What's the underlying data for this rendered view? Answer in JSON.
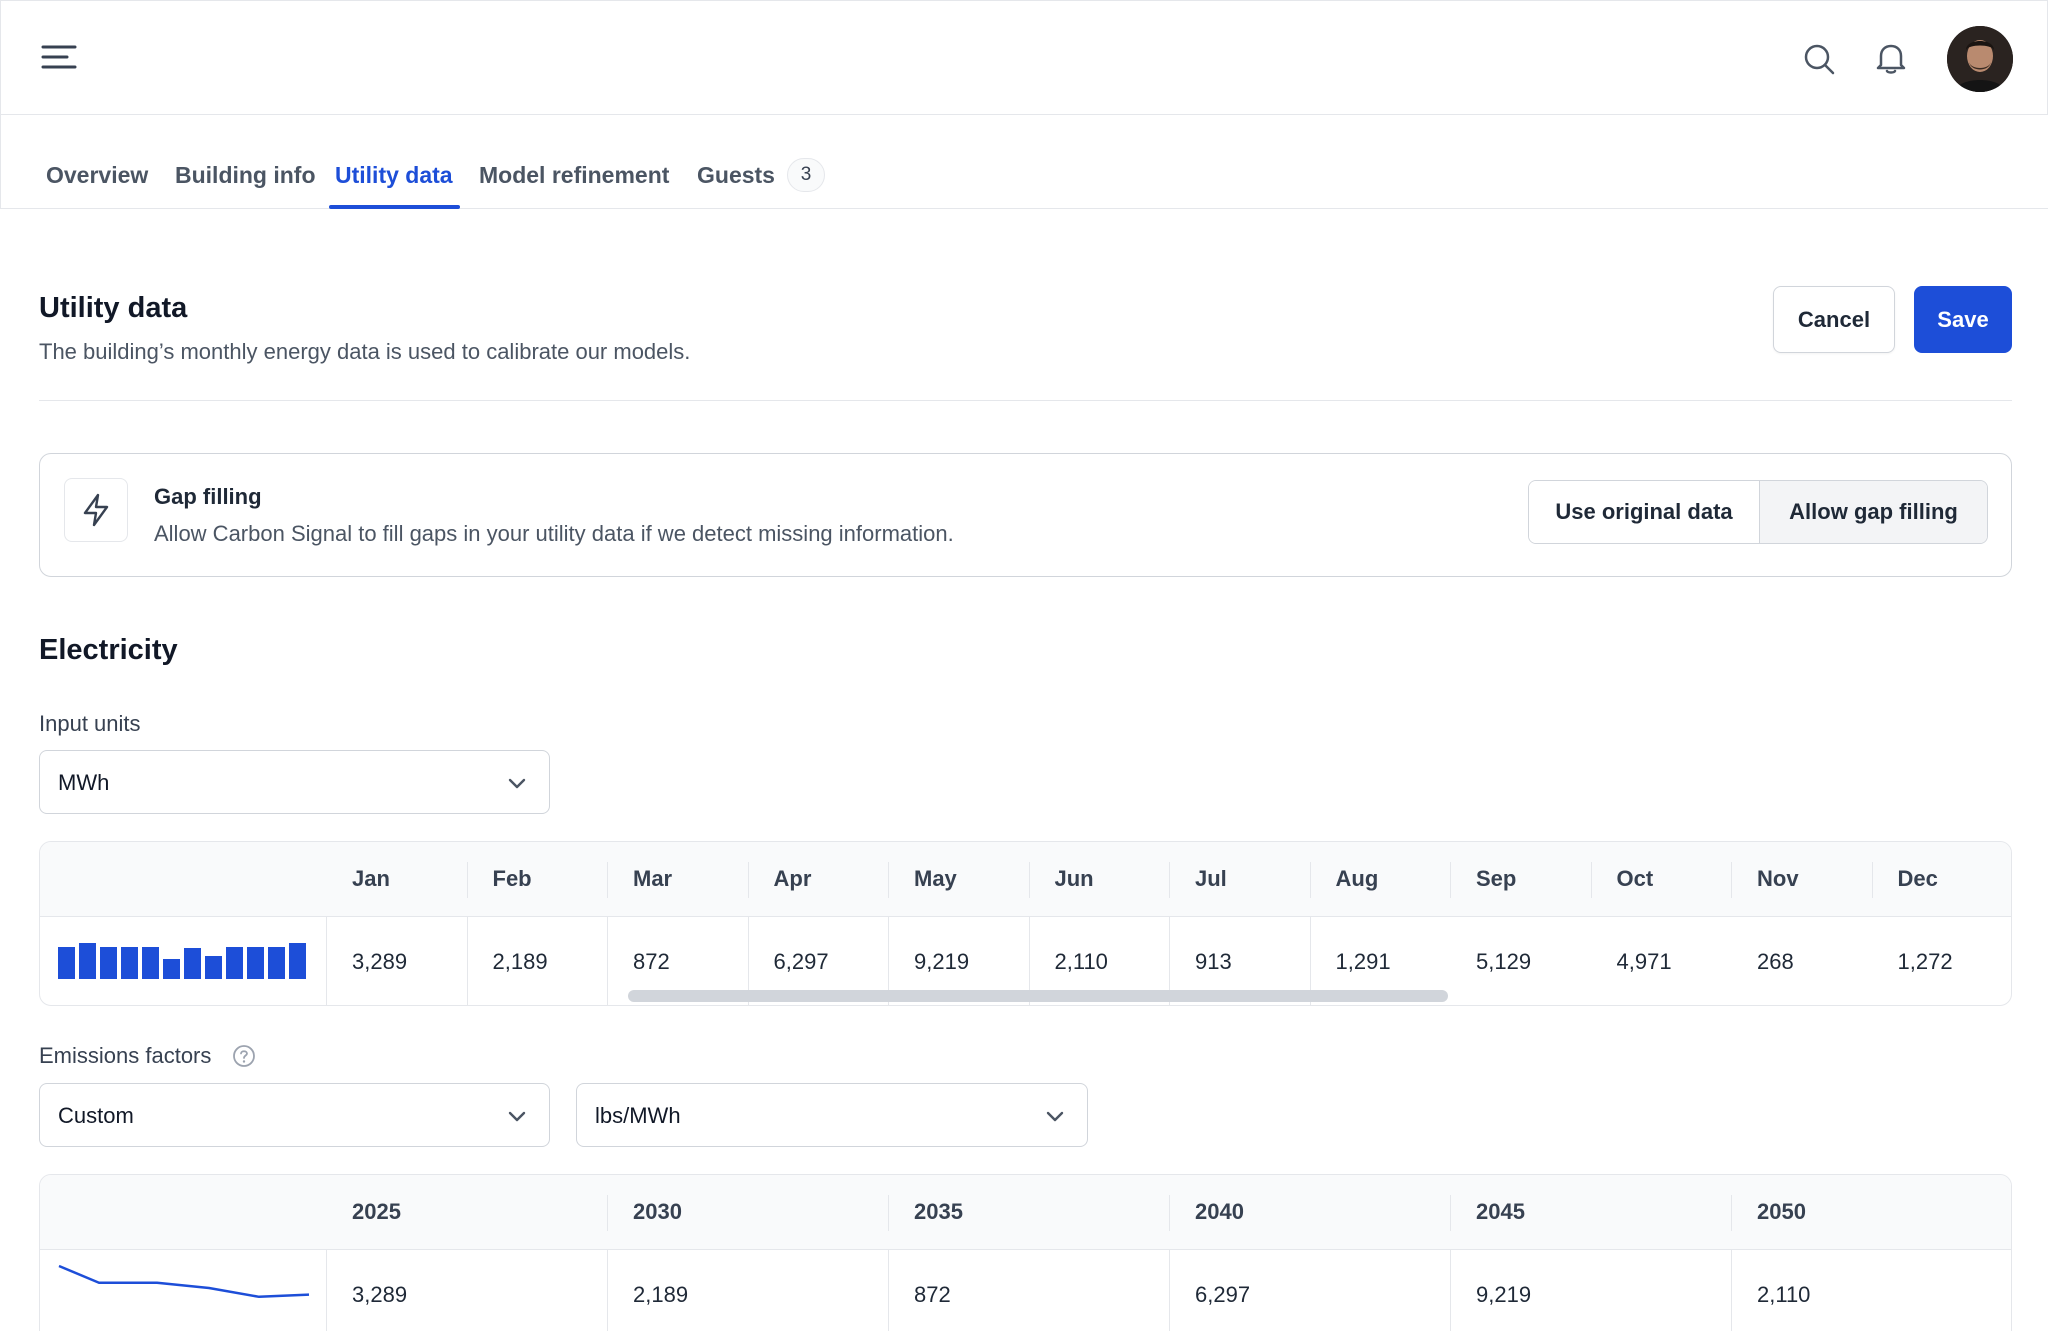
{
  "header": {
    "menu_icon": "hamburger-menu-icon",
    "search_icon": "search-icon",
    "bell_icon": "bell-icon"
  },
  "tabs": {
    "overview": "Overview",
    "building_info": "Building info",
    "utility_data": "Utility data",
    "model_refinement": "Model refinement",
    "guests": "Guests",
    "guests_count": "3",
    "active": "utility_data"
  },
  "page": {
    "title": "Utility data",
    "subtitle": "The building’s monthly energy data is used to calibrate our models.",
    "cancel_label": "Cancel",
    "save_label": "Save"
  },
  "gap_filling": {
    "icon": "lightning-bolt-icon",
    "title": "Gap filling",
    "description": "Allow Carbon Signal to fill gaps in your utility data if we detect missing information.",
    "option_original": "Use original data",
    "option_gap_filling": "Allow gap filling",
    "selected": "option_gap_filling"
  },
  "electricity": {
    "title": "Electricity",
    "input_units_label": "Input units",
    "input_units_value": "MWh",
    "months": [
      "Jan",
      "Feb",
      "Mar",
      "Apr",
      "May",
      "Jun",
      "Jul",
      "Aug",
      "Sep",
      "Oct",
      "Nov",
      "Dec"
    ],
    "values": [
      "3,289",
      "2,189",
      "872",
      "6,297",
      "9,219",
      "2,110",
      "913",
      "1,291",
      "5,129",
      "4,971",
      "268",
      "1,272"
    ],
    "sparkline_bar_levels": [
      0.9,
      1.0,
      0.9,
      0.9,
      0.9,
      0.55,
      0.85,
      0.65,
      0.9,
      0.9,
      0.9,
      1.0
    ]
  },
  "emissions": {
    "label": "Emissions factors",
    "help_icon": "question-circle-icon",
    "factor_value": "Custom",
    "unit_value": "lbs/MWh",
    "years": [
      "2025",
      "2030",
      "2035",
      "2040",
      "2045",
      "2050"
    ],
    "values": [
      "3,289",
      "2,189",
      "872",
      "6,297",
      "9,219",
      "2,110"
    ],
    "sparkline_levels": [
      1.0,
      0.62,
      0.62,
      0.5,
      0.3,
      0.35
    ]
  },
  "colors": {
    "accent": "#1d4ed8",
    "border": "#e5e7eb"
  }
}
